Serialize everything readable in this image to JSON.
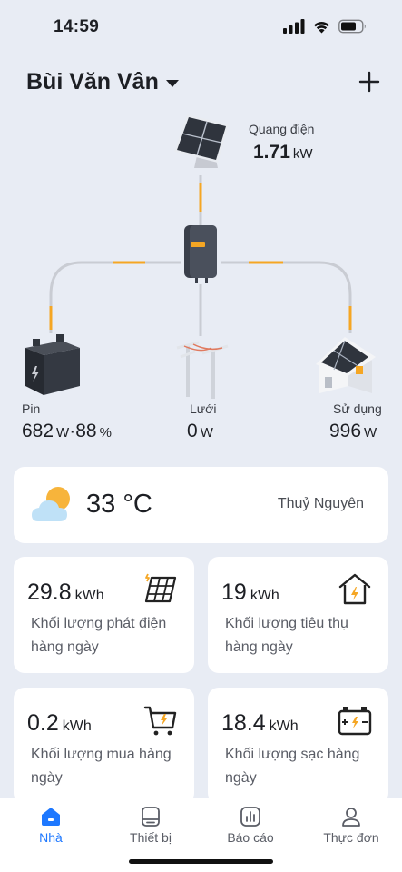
{
  "status": {
    "time": "14:59"
  },
  "header": {
    "station_name": "Bùi Văn Vân"
  },
  "flow": {
    "pv": {
      "label": "Quang điện",
      "value": "1.71",
      "unit": "kW"
    },
    "battery": {
      "label": "Pin",
      "power": "682",
      "power_unit": "W",
      "separator": "·",
      "soc": "88",
      "soc_unit": "%"
    },
    "grid": {
      "label": "Lưới",
      "value": "0",
      "unit": "W"
    },
    "load": {
      "label": "Sử dụng",
      "value": "996",
      "unit": "W"
    }
  },
  "weather": {
    "temperature": "33 °C",
    "location": "Thuỷ Nguyên"
  },
  "stats": [
    {
      "value": "29.8",
      "unit": "kWh",
      "label": "Khối lượng phát điện hàng ngày",
      "icon": "solar-panel-icon"
    },
    {
      "value": "19",
      "unit": "kWh",
      "label": "Khối lượng tiêu thụ hàng ngày",
      "icon": "house-power-icon"
    },
    {
      "value": "0.2",
      "unit": "kWh",
      "label": "Khối lượng mua hàng ngày",
      "icon": "cart-power-icon"
    },
    {
      "value": "18.4",
      "unit": "kWh",
      "label": "Khối lượng sạc hàng ngày",
      "icon": "battery-charge-icon"
    }
  ],
  "tabs": [
    {
      "label": "Nhà",
      "icon": "home-icon",
      "active": true
    },
    {
      "label": "Thiết bị",
      "icon": "device-icon",
      "active": false
    },
    {
      "label": "Báo cáo",
      "icon": "report-icon",
      "active": false
    },
    {
      "label": "Thực đơn",
      "icon": "user-icon",
      "active": false
    }
  ],
  "colors": {
    "accent": "#1e78ff",
    "flow_active": "#f5a623",
    "flow_line": "#c9ccd3"
  }
}
